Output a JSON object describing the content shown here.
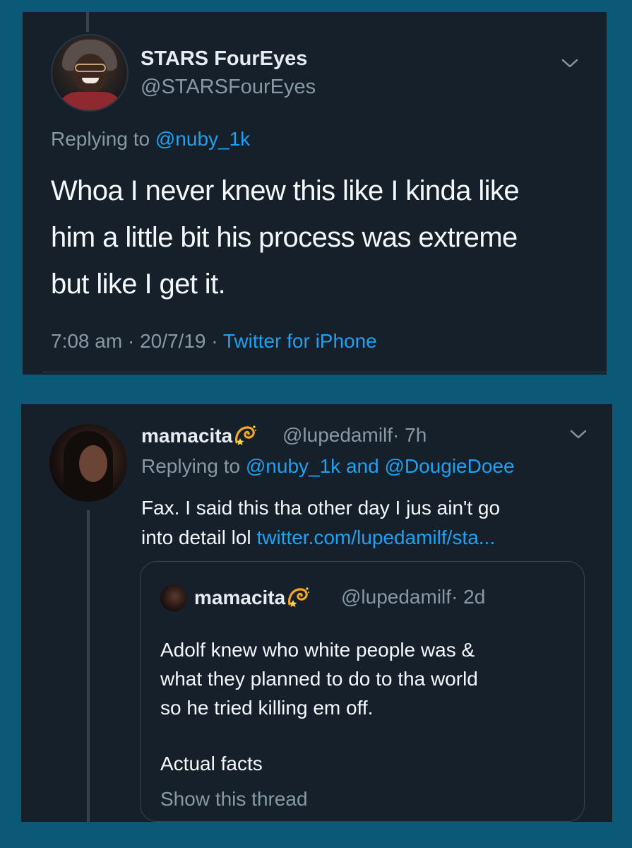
{
  "colors": {
    "background": "#0c5877",
    "card": "#15202b",
    "text": "#f5f8fa",
    "muted": "#8899a6",
    "link": "#1da1f2",
    "border": "#38444d"
  },
  "tweet1": {
    "display_name": "STARS FourEyes",
    "handle": "@STARSFourEyes",
    "replying_prefix": "Replying to",
    "replying_to": "@nuby_1k",
    "text_line1": "Whoa I never knew this like I kinda like",
    "text_line2": "him a little bit his process was extreme",
    "text_line3": "but like I get it.",
    "time": "7:08 am",
    "date": "20/7/19",
    "source": "Twitter for iPhone",
    "separator": "·",
    "menu_icon": "chevron-down-icon"
  },
  "tweet2": {
    "display_name": "mamacita",
    "emoji_icon": "dizzy-emoji-icon",
    "handle": "@lupedamilf",
    "age": "· 7h",
    "replying_prefix": "Replying to",
    "replying_to_1": "@nuby_1k",
    "replying_and": "and",
    "replying_to_2": "@DougieDoee",
    "text_line1": "Fax. I said this tha other day I jus ain't go",
    "text_line2_plain": "into detail lol",
    "text_line2_link": "twitter.com/lupedamilf/sta...",
    "menu_icon": "chevron-down-icon",
    "quoted": {
      "display_name": "mamacita",
      "handle": "@lupedamilf",
      "age": "· 2d",
      "text_line1": "Adolf knew who white people was &",
      "text_line2": "what they planned to do to tha world",
      "text_line3": "so he tried killing em off.",
      "text_line4": "Actual facts",
      "show_thread": "Show this thread"
    }
  }
}
